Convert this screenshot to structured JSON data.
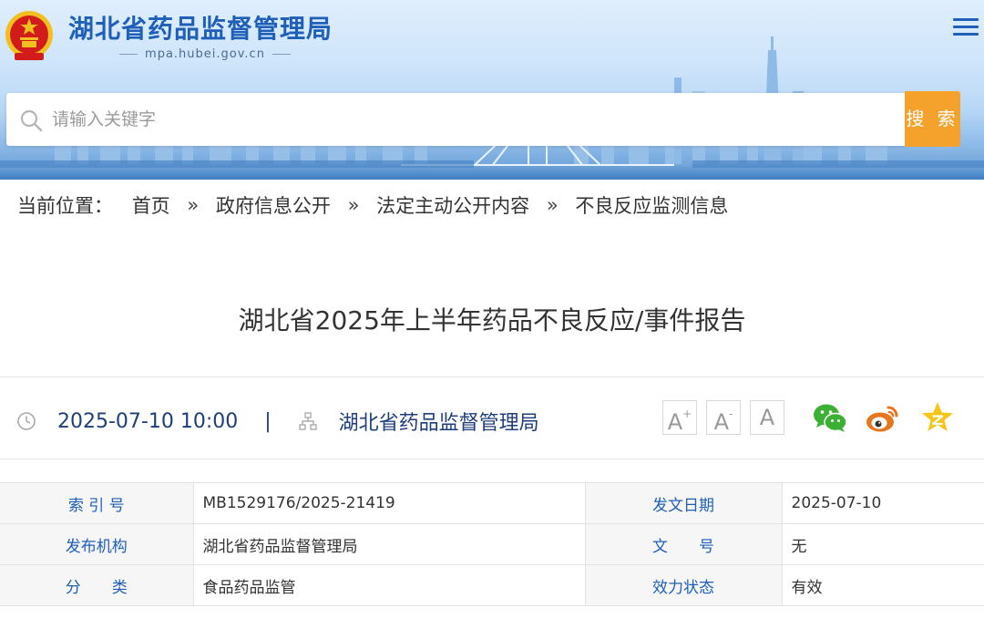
{
  "site": {
    "title": "湖北省药品监督管理局",
    "domain": "mpa.hubei.gov.cn"
  },
  "search": {
    "placeholder": "请输入关键字",
    "button_label": "搜 索"
  },
  "breadcrumb": {
    "prefix": "当前位置：",
    "items": [
      "首页",
      "政府信息公开",
      "法定主动公开内容",
      "不良反应监测信息"
    ],
    "separator": "»"
  },
  "article": {
    "title": "湖北省2025年上半年药品不良反应/事件报告",
    "datetime": "2025-07-10 10:00",
    "divider": "|",
    "publisher": "湖北省药品监督管理局"
  },
  "font_controls": {
    "increase": "A",
    "decrease": "A",
    "reset": "A"
  },
  "share": {
    "icons": [
      "wechat-icon",
      "weibo-icon",
      "qzone-icon"
    ],
    "colors": {
      "wechat": "#3cb034",
      "weibo": "#e8761e",
      "qzone": "#f5c518"
    }
  },
  "info": {
    "rows": [
      {
        "label1": "索 引 号",
        "value1": "MB1529176/2025-21419",
        "label2": "发文日期",
        "value2": "2025-07-10"
      },
      {
        "label1": "发布机构",
        "value1": "湖北省药品监督管理局",
        "label2": "文　　号",
        "value2": "无"
      },
      {
        "label1": "分　　类",
        "value1": "食品药品监管",
        "label2": "效力状态",
        "value2": "有效"
      }
    ]
  },
  "colors": {
    "brand_blue": "#1f5fb8",
    "search_orange": "#f4a22b",
    "emblem_red": "#d21c1c",
    "emblem_gold": "#f2c01e"
  }
}
